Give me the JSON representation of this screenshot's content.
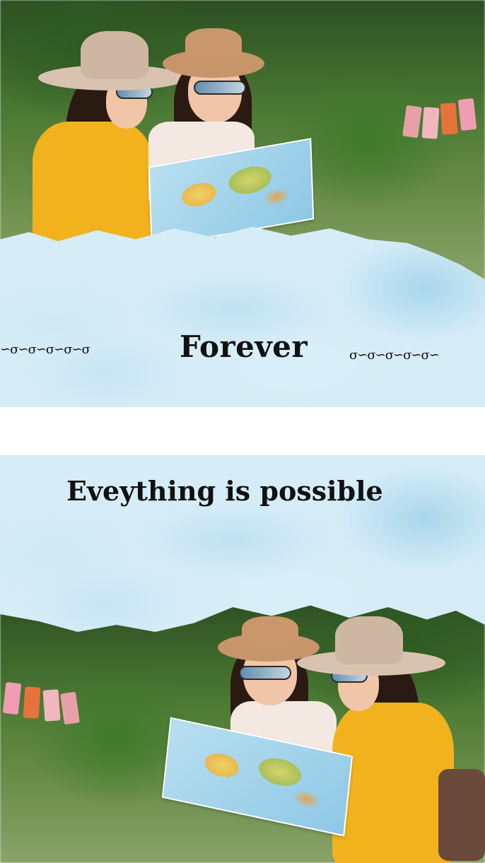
{
  "top_section": {
    "title": "Forever",
    "ornament_left": "∽σ∽σ∽σ∽σ∽σ",
    "ornament_right": "σ∽σ∽σ∽σ∽σ∽"
  },
  "bottom_section": {
    "title": "Eveything is possible"
  },
  "colors": {
    "wash_blue": "#d6edf7",
    "sweater_yellow": "#f2b21d",
    "text": "#111111",
    "background": "#ffffff"
  },
  "icons": {
    "divider": "scroll-ornament-icon"
  }
}
